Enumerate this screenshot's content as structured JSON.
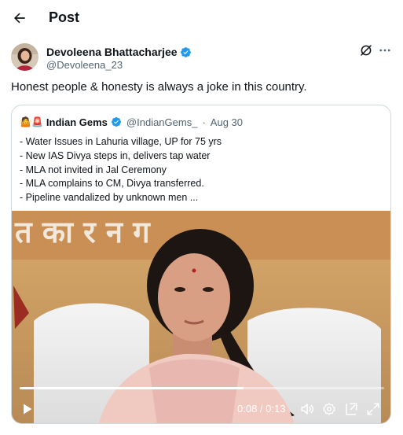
{
  "header": {
    "title": "Post"
  },
  "author": {
    "name": "Devoleena Bhattacharjee",
    "handle": "@Devoleena_23",
    "verified": true
  },
  "post": {
    "text": "Honest people & honesty is always a joke in this country."
  },
  "quote": {
    "emojis": "🤷🚨",
    "name": "Indian Gems",
    "handle": "@IndianGems_",
    "separator": "·",
    "date": "Aug 30",
    "lines": [
      "- Water Issues in Lahuria village, UP for 75 yrs",
      "- New IAS Divya steps in, delivers tap water",
      "- MLA not invited in Jal Ceremony",
      "- MLA complains to CM, Divya transferred.",
      "- Pipeline vandalized by unknown men ..."
    ]
  },
  "video": {
    "time": "0:08 / 0:13",
    "progress": 0.615,
    "backdrop_text": "त  का र  न ग"
  },
  "colors": {
    "verified": "#1d9bf0",
    "muted": "#536471",
    "border": "#cfd9de"
  }
}
